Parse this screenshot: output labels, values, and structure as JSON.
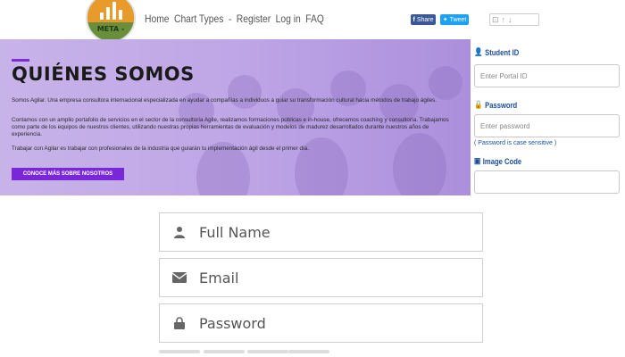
{
  "header": {
    "logo_text": "META -",
    "nav": [
      "Home",
      "Chart Types",
      "-",
      "Register",
      "Log in",
      "FAQ"
    ],
    "facebook_label": "Share",
    "twitter_label": "Tweet"
  },
  "banner": {
    "title": "QUIÉNES SOMOS",
    "paragraphs": [
      "Somos Agilar. Una empresa consultora internacional especializada en ayudar a compañías a individuos a guiar su transformación cultural hacia métodos de trabajo ágiles.",
      "Contamos con un amplio portafolio de servicios en el sector de la consultoría Agile, realizamos formaciones públicas e in-house, ofrecemos coaching y consultoría. Trabajamos como parte de los equipos de nuestros clientes, utilizando nuestras propias herramientas de evaluación y modelos de madurez desarrollados durante nuestros años de experiencia.",
      "Trabajar con Agilar es trabajar con profesionales de la industria que guiarán tu implementación ágil desde el primer día."
    ],
    "cta": "CONOCE MÁS SOBRE NOSOTROS"
  },
  "login": {
    "student_id_label": "Student ID",
    "student_id_placeholder": "Enter Portal ID",
    "password_label": "Password",
    "password_placeholder": "Enter password",
    "password_hint": "( Password is case sensitive )",
    "image_code_label": "Image Code"
  },
  "signup": {
    "full_name": "Full Name",
    "email": "Email",
    "password": "Password"
  },
  "colors": {
    "accent_purple": "#7a27d9",
    "link_blue": "#1a4d9e",
    "facebook": "#3b5998",
    "twitter": "#1da1f2"
  }
}
